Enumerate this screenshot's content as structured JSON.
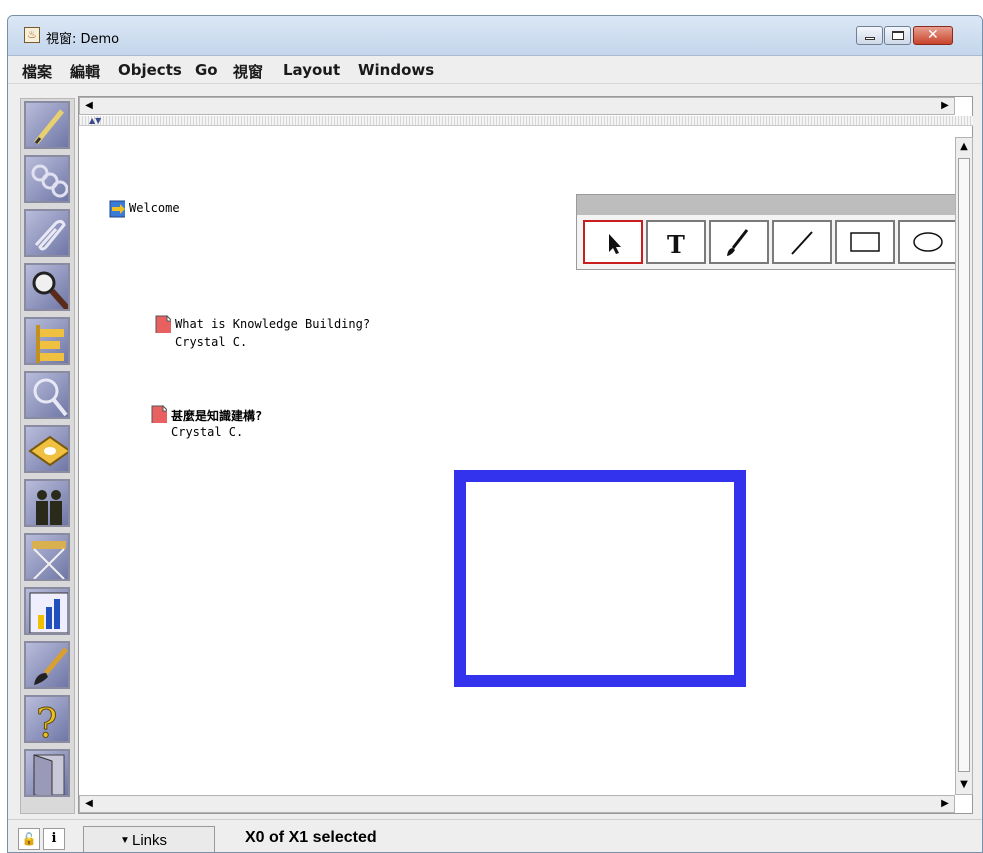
{
  "window": {
    "title": "視窗: Demo",
    "title_icon": "java-cup-icon",
    "min_icon": "minimize-icon",
    "max_icon": "maximize-icon",
    "close_icon": "close-icon",
    "close_glyph": "✕"
  },
  "menu": [
    {
      "label": "檔案"
    },
    {
      "label": "編輯"
    },
    {
      "label": "Objects"
    },
    {
      "label": "Go"
    },
    {
      "label": "視窗"
    },
    {
      "label": "Layout"
    },
    {
      "label": "Windows"
    }
  ],
  "left_tools": [
    {
      "name": "pencil-icon"
    },
    {
      "name": "link-chain-icon"
    },
    {
      "name": "paperclip-icon"
    },
    {
      "name": "search-magnifier-icon"
    },
    {
      "name": "signpost-icon"
    },
    {
      "name": "magnifier-icon"
    },
    {
      "name": "book-icon"
    },
    {
      "name": "people-icon"
    },
    {
      "name": "easel-icon"
    },
    {
      "name": "bar-chart-icon"
    },
    {
      "name": "paintbrush-icon"
    },
    {
      "name": "help-question-icon"
    },
    {
      "name": "door-exit-icon"
    }
  ],
  "canvas": {
    "objects": [
      {
        "type": "view-link",
        "icon": "view-arrow-icon",
        "title": "Welcome"
      },
      {
        "type": "note",
        "icon": "note-page-icon",
        "title": "What is Knowledge Building?",
        "author": "Crystal C."
      },
      {
        "type": "note",
        "icon": "note-page-icon",
        "title": "甚麼是知識建構?",
        "author": "Crystal C."
      }
    ],
    "shape_color": "#3333ee",
    "selected_tool_border": "#c81e1e"
  },
  "drawing_toolbar": {
    "tools": [
      {
        "name": "select-arrow-icon",
        "glyph": "➤",
        "selected": true
      },
      {
        "name": "text-tool-icon",
        "glyph": "T",
        "selected": false
      },
      {
        "name": "brush-tool-icon",
        "glyph": "",
        "selected": false
      },
      {
        "name": "line-tool-icon",
        "glyph": "",
        "selected": false
      },
      {
        "name": "rectangle-tool-icon",
        "glyph": "",
        "selected": false
      },
      {
        "name": "ellipse-tool-icon",
        "glyph": "",
        "selected": false
      }
    ]
  },
  "statusbar": {
    "lock_icon": "lock-icon",
    "info_label": "i",
    "links_label": "Links",
    "links_dropdown_icon": "triangle-down-icon",
    "status": "X0 of X1 selected"
  }
}
